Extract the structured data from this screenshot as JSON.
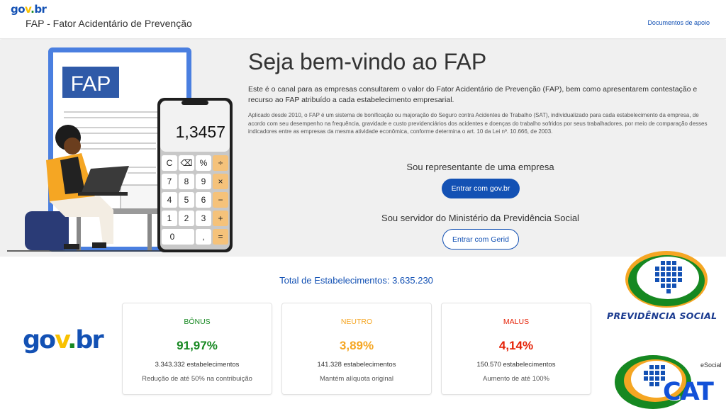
{
  "header": {
    "logo": {
      "part1": "go",
      "part2": "v",
      "part3": ".",
      "part4": "br"
    },
    "app_title": "FAP - Fator Acidentário de Prevenção",
    "link_docs": "Documentos de apoio"
  },
  "hero": {
    "illustration": {
      "doc_label": "FAP",
      "calc_display": "1,3457",
      "calc_keys": [
        "C",
        "⌫",
        "%",
        "÷",
        "7",
        "8",
        "9",
        "×",
        "4",
        "5",
        "6",
        "−",
        "1",
        "2",
        "3",
        "+",
        "0",
        ",",
        "="
      ]
    },
    "title": "Seja bem-vindo ao FAP",
    "intro": "Este é o canal para as empresas consultarem o valor do Fator Acidentário de Prevenção (FAP), bem como apresentarem contestação e recurso ao FAP atribuído a cada estabelecimento empresarial.",
    "detail": "Aplicado desde 2010, o FAP é um sistema de bonificação ou majoração do Seguro contra Acidentes de Trabalho (SAT), individualizado para cada estabelecimento da empresa, de acordo com seu desempenho na frequência, gravidade e custo previdenciários dos acidentes e doenças do trabalho sofridos por seus trabalhadores, por meio de comparação desses indicadores entre as empresas da mesma atividade econômica, conforme determina o art. 10 da Lei nº. 10.666, de 2003.",
    "rep_title": "Sou representante de uma empresa",
    "btn_govbr": "Entrar com gov.br",
    "serv_title": "Sou servidor do Ministério da Previdência Social",
    "btn_gerid": "Entrar com Gerid"
  },
  "stats": {
    "total": "Total de Estabelecimentos: 3.635.230",
    "cards": [
      {
        "title": "BÔNUS",
        "pct": "91,97%",
        "count": "3.343.332 estabelecimentos",
        "desc": "Redução de até 50% na contribuição",
        "color": "#168821"
      },
      {
        "title": "NEUTRO",
        "pct": "3,89%",
        "count": "141.328 estabelecimentos",
        "desc": "Mantém alíquota original",
        "color": "#f5a623"
      },
      {
        "title": "MALUS",
        "pct": "4,14%",
        "count": "150.570 estabelecimentos",
        "desc": "Aumento de até 100%",
        "color": "#e52207"
      }
    ]
  },
  "logos": {
    "govbr": {
      "part1": "go",
      "part2": "v",
      "part3": ".",
      "part4": "br"
    },
    "previdencia": "PREVIDÊNCIA SOCIAL",
    "esocial": "eSocial",
    "cat": "CAT"
  },
  "colors": {
    "primary": "#1351b4",
    "hero_bg": "#f0f0f0",
    "orange": "#f5a623",
    "dark": "#2b2b2b"
  }
}
